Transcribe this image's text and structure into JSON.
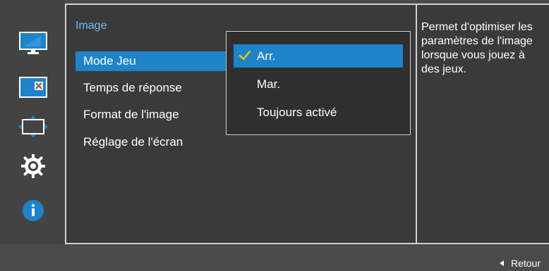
{
  "panel": {
    "title": "Image"
  },
  "menu": {
    "items": [
      {
        "label": "Mode Jeu"
      },
      {
        "label": "Temps de réponse"
      },
      {
        "label": "Format de l'image"
      },
      {
        "label": "Réglage de l'écran"
      }
    ]
  },
  "dropdown": {
    "items": [
      {
        "label": "Arr."
      },
      {
        "label": "Mar."
      },
      {
        "label": "Toujours activé"
      }
    ]
  },
  "description": {
    "text": "Permet d'optimiser les paramètres de l'image lorsque vous jouez à des jeux."
  },
  "footer": {
    "return_label": "Retour"
  },
  "icons": {
    "rail": [
      "monitor-icon",
      "image-size-icon",
      "position-icon",
      "settings-icon",
      "info-icon"
    ],
    "check": "checkmark-icon",
    "back": "triangle-left-icon"
  },
  "colors": {
    "accent": "#1d84c9",
    "title": "#76b8f5",
    "check": "#f2c200",
    "info": "#1d84c9"
  }
}
